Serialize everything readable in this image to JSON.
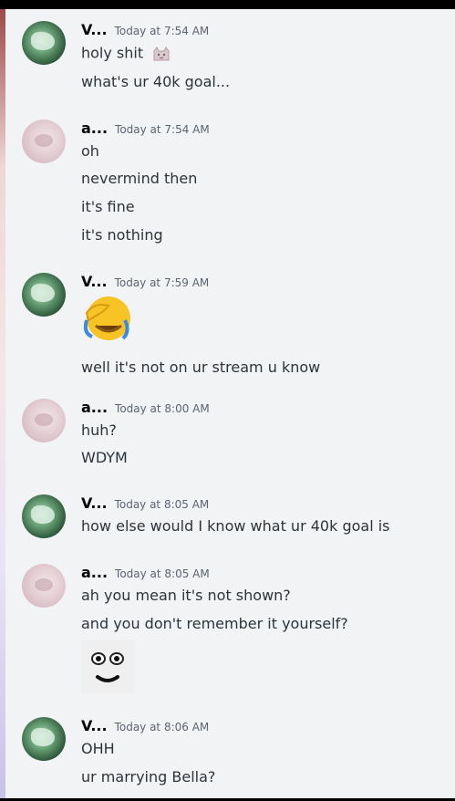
{
  "messages": [
    {
      "user": "V...",
      "time": "Today at 7:54 AM",
      "lines": [
        "holy shit",
        "what's ur 40k goal..."
      ],
      "inline_emoji": "cat-emoji"
    },
    {
      "user": "a...",
      "time": "Today at 7:54 AM",
      "lines": [
        "oh",
        "nevermind then",
        "it's fine",
        "it's nothing"
      ]
    },
    {
      "user": "V...",
      "time": "Today at 7:59 AM",
      "emoji": "face-palm-emoji",
      "lines": [
        "well it's not on ur stream u know"
      ]
    },
    {
      "user": "a...",
      "time": "Today at 8:00 AM",
      "lines": [
        "huh?",
        "WDYM"
      ]
    },
    {
      "user": "V...",
      "time": "Today at 8:05 AM",
      "lines": [
        "how else would I know what ur 40k goal is"
      ]
    },
    {
      "user": "a...",
      "time": "Today at 8:05 AM",
      "lines": [
        "ah you mean it's not shown?",
        "and you don't remember it yourself?"
      ],
      "image": "staring-face-meme"
    },
    {
      "user": "V...",
      "time": "Today at 8:06 AM",
      "lines": [
        "OHH",
        "ur marrying Bella?"
      ]
    }
  ],
  "colors": {
    "background": "#f2f3f5",
    "username": "#060607",
    "timestamp": "#5c6370",
    "text": "#2e3338"
  }
}
